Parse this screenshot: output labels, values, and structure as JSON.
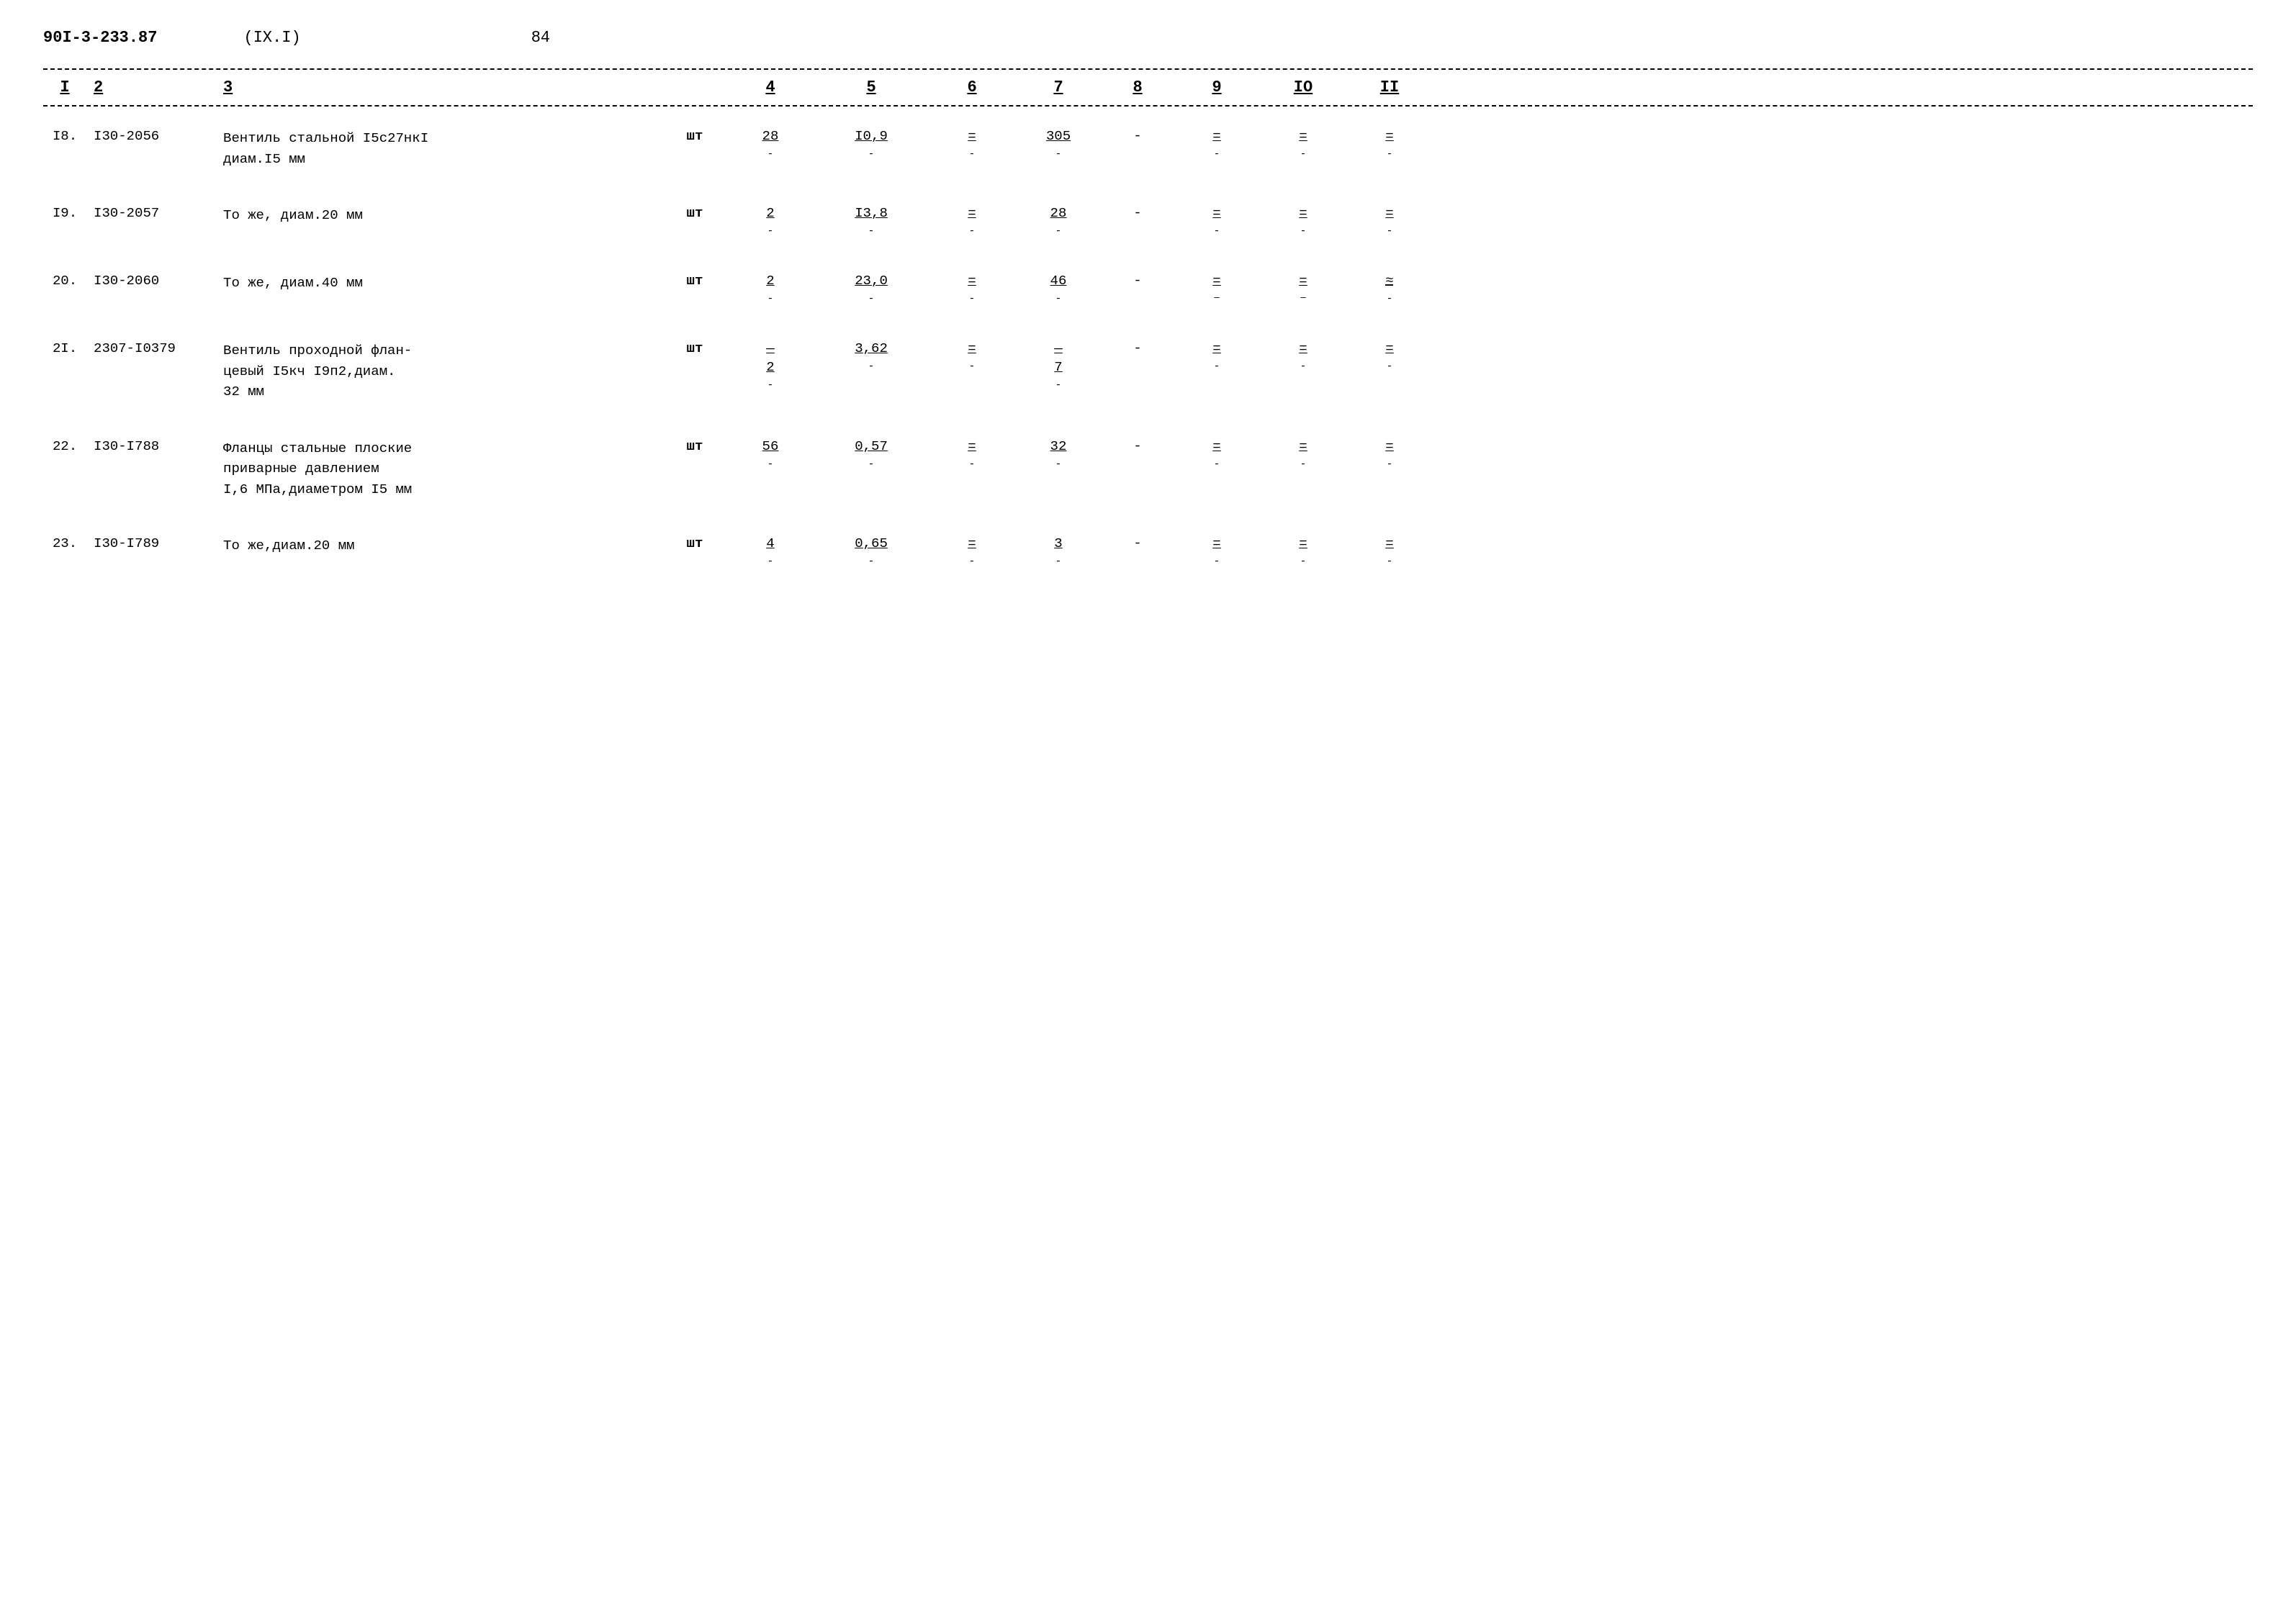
{
  "header": {
    "doc_number": "90I-3-233.87",
    "section": "(IX.I)",
    "page": "84"
  },
  "columns": {
    "headers": [
      "I",
      "2",
      "3",
      "4",
      "5",
      "6",
      "7",
      "8",
      "9",
      "IO",
      "II"
    ]
  },
  "rows": [
    {
      "num": "I8.",
      "code": "I30-2056",
      "description": "Вентиль стальной I5с27нкI\nдиам.I5 мм",
      "unit": "шт",
      "col4": "28",
      "col5": "I0,9",
      "col6": "=",
      "col7": "305",
      "col8": "-",
      "col9": "=",
      "col10": "=",
      "col11": "="
    },
    {
      "num": "I9.",
      "code": "I30-2057",
      "description": "То же, диам.20 мм",
      "unit": "шт",
      "col4": "2",
      "col5": "I3,8",
      "col6": "=",
      "col7": "28",
      "col8": "-",
      "col9": "=",
      "col10": "=",
      "col11": "="
    },
    {
      "num": "20.",
      "code": "I30-2060",
      "description": "То же, диам.40 мм",
      "unit": "шт",
      "col4": "2",
      "col5": "23,0",
      "col6": "=",
      "col7": "46",
      "col8": "-",
      "col9": "=",
      "col10": "=",
      "col11": "="
    },
    {
      "num": "2I.",
      "code": "2307-I0379",
      "description": "Вентиль проходной флан-\nцевый I5кч I9п2,диам.\n32 мм",
      "unit": "шт",
      "col4": "—\n2",
      "col5": "3,62",
      "col6": "=",
      "col7": "—\n7",
      "col8": "-",
      "col9": "=",
      "col10": "=",
      "col11": "="
    },
    {
      "num": "22.",
      "code": "I30-I788",
      "description": "Фланцы стальные плоские\nприварные давлением\nI,6 МПа,диаметром I5 мм",
      "unit": "шт",
      "col4": "56",
      "col5": "0,57",
      "col6": "=",
      "col7": "32",
      "col8": "-",
      "col9": "=",
      "col10": "=",
      "col11": "="
    },
    {
      "num": "23.",
      "code": "I30-I789",
      "description": "То же,диам.20 мм",
      "unit": "шт",
      "col4": "4",
      "col5": "0,65",
      "col6": "=",
      "col7": "3",
      "col8": "-",
      "col9": "=",
      "col10": "=",
      "col11": "="
    }
  ]
}
